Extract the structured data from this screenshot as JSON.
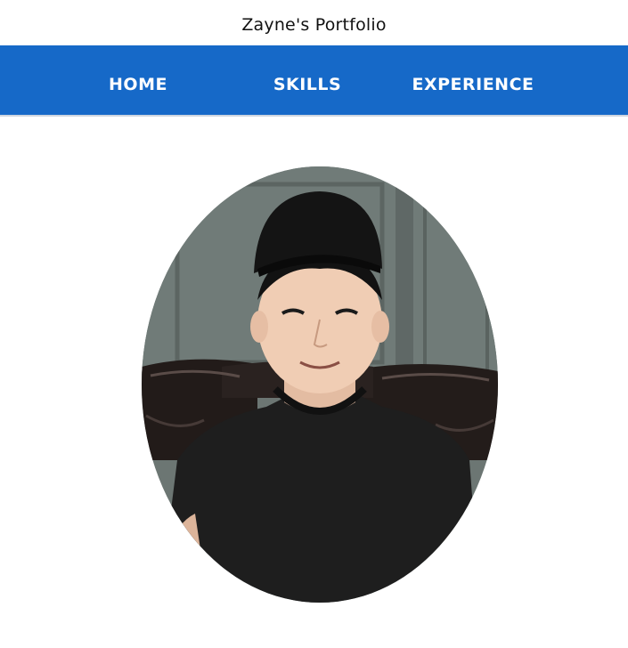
{
  "header": {
    "title": "Zayne's Portfolio"
  },
  "nav": {
    "items": [
      {
        "label": "HOME"
      },
      {
        "label": "SKILLS"
      },
      {
        "label": "EXPERIENCE"
      }
    ]
  },
  "profile": {
    "photo_alt": "portrait photo"
  },
  "colors": {
    "nav_background": "#1669c8",
    "nav_text": "#ffffff",
    "page_background": "#ffffff"
  }
}
